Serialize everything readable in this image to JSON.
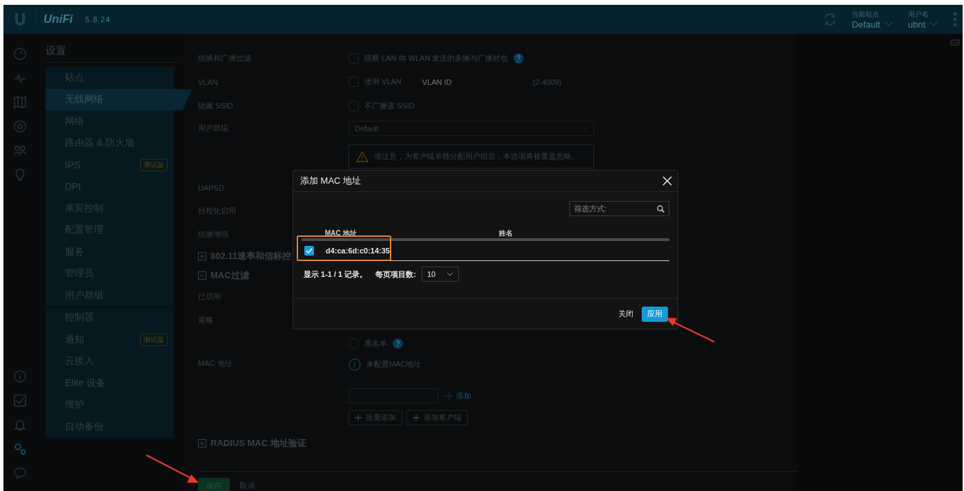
{
  "header": {
    "brand": "UniFi",
    "version": "5.8.24",
    "site_label": "当前站点",
    "site": "Default",
    "user_label": "用户名",
    "user": "ubnt"
  },
  "nav_icons": [
    {
      "kind": "dashboard",
      "selected": false
    },
    {
      "kind": "stats",
      "selected": false
    },
    {
      "kind": "map",
      "selected": false
    },
    {
      "kind": "devices",
      "selected": false
    },
    {
      "kind": "clients",
      "selected": false
    },
    {
      "kind": "insights",
      "selected": false
    },
    {
      "kind": "info",
      "selected": false
    },
    {
      "kind": "tasks",
      "selected": false
    },
    {
      "kind": "alerts",
      "selected": false
    },
    {
      "kind": "settings",
      "selected": true
    },
    {
      "kind": "chat",
      "selected": false
    }
  ],
  "sidebar": {
    "title": "设置",
    "groups": [
      {
        "items": [
          {
            "label": "站点",
            "selected": false
          },
          {
            "label": "无线网络",
            "selected": true
          },
          {
            "label": "网络",
            "selected": false
          },
          {
            "label": "路由器 & 防火墙",
            "selected": false
          },
          {
            "label": "IPS",
            "selected": false,
            "badge": "测试版"
          },
          {
            "label": "DPI",
            "selected": false
          },
          {
            "label": "来宾控制",
            "selected": false
          },
          {
            "label": "配置管理",
            "selected": false
          },
          {
            "label": "服务",
            "selected": false
          },
          {
            "label": "管理员",
            "selected": false
          },
          {
            "label": "用户群组",
            "selected": false
          }
        ]
      },
      {
        "items": [
          {
            "label": "控制器",
            "selected": false
          },
          {
            "label": "通知",
            "selected": false,
            "badge": "测试版"
          },
          {
            "label": "云接入",
            "selected": false
          },
          {
            "label": "Elite 设备",
            "selected": false
          },
          {
            "label": "维护",
            "selected": false
          },
          {
            "label": "自动备份",
            "selected": false
          }
        ]
      }
    ]
  },
  "form": {
    "rows": [
      {
        "kind": "checkbox",
        "label": "组播和广播过滤",
        "text": "阻断 LAN 向 WLAN 发送的多播与广播封包",
        "checked": false,
        "help": true
      },
      {
        "kind": "checkbox",
        "label": "VLAN",
        "text": "使用 VLAN",
        "checked": false,
        "placeholder": "VLAN ID",
        "hint": "(2-4009)"
      },
      {
        "kind": "checkbox",
        "label": "隐藏 SSID",
        "text": "不广播该 SSID",
        "checked": false
      },
      {
        "kind": "select",
        "label": "用户群组",
        "value": "Default"
      },
      {
        "kind": "warning",
        "text": "请注意，为客户端单独分配用户组后，本选项将被覆盖忽略。"
      },
      {
        "kind": "label",
        "label": "UAPSD"
      },
      {
        "kind": "label",
        "label": "日程化启用"
      },
      {
        "kind": "label",
        "label": "组播增强"
      },
      {
        "kind": "section",
        "title": "802.11速率和信标控",
        "expanded": false
      },
      {
        "kind": "section",
        "title": "MAC过滤",
        "expanded": true
      },
      {
        "kind": "label",
        "label": "已启用"
      },
      {
        "kind": "label",
        "label": "策略"
      },
      {
        "kind": "radio",
        "text": "黑名单",
        "selected": false,
        "help": true
      },
      {
        "kind": "info",
        "label": "MAC 地址",
        "text": "未配置MAC地址"
      },
      {
        "kind": "mac-input",
        "add": "添加"
      },
      {
        "kind": "buttons",
        "buttons": [
          "批量添加",
          "添加客户端"
        ]
      },
      {
        "kind": "section",
        "title": "RADIUS MAC 地址验证",
        "expanded": false
      }
    ],
    "footer": {
      "save": "保存",
      "cancel": "取消"
    }
  },
  "modal": {
    "title": "添加 MAC 地址",
    "filter_placeholder": "筛选方式:",
    "columns": [
      "MAC 地址",
      "姓名"
    ],
    "rows": [
      {
        "mac": "d4:ca:6d:c0:14:35",
        "selected": true
      }
    ],
    "pager": "显示 1-1 / 1 记录。",
    "per_page_label": "每页项目数:",
    "per_page": "10",
    "close": "关闭",
    "apply": "应用"
  }
}
